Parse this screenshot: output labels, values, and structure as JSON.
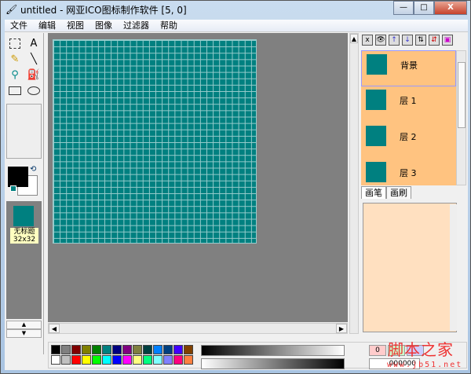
{
  "window": {
    "title": "untitled - 网亚ICO图标制作软件 [5, 0]",
    "minimize": "—",
    "maximize": "□",
    "close": "X"
  },
  "menu": [
    "文件",
    "编辑",
    "视图",
    "图像",
    "过滤器",
    "帮助"
  ],
  "tools": {
    "text": "A",
    "line": "╲",
    "pencil": "✎",
    "picker": "⚲",
    "fill": "⛽"
  },
  "colors": {
    "foreground": "#000000",
    "background": "#FFFFFF",
    "canvas": "#008080",
    "swap": "⟲"
  },
  "icon_list": {
    "items": [
      {
        "name": "无标题",
        "size": "32x32"
      }
    ],
    "up": "▲",
    "down": "▼"
  },
  "canvas": {
    "grid_cols": 32,
    "grid_rows": 32
  },
  "layer_toolbar": [
    "x",
    "👁",
    "↑",
    "↓",
    "⇅",
    "⇵",
    "▣"
  ],
  "layers": [
    {
      "name": "背景"
    },
    {
      "name": "层 1"
    },
    {
      "name": "层 2"
    },
    {
      "name": "层 3"
    }
  ],
  "tabs": [
    "画笔",
    "画刷"
  ],
  "palette": {
    "row1": [
      "#000000",
      "#808080",
      "#800000",
      "#808000",
      "#008000",
      "#008080",
      "#000080",
      "#800080",
      "#808040",
      "#004040",
      "#0080FF",
      "#004080",
      "#4000FF",
      "#804000"
    ],
    "row2": [
      "#FFFFFF",
      "#C0C0C0",
      "#FF0000",
      "#FFFF00",
      "#00FF00",
      "#00FFFF",
      "#0000FF",
      "#FF00FF",
      "#FFFF80",
      "#00FF80",
      "#80FFFF",
      "#8080FF",
      "#FF0080",
      "#FF8040"
    ]
  },
  "color_value": "0",
  "hex_value": "000000",
  "watermark": {
    "title": "脚本之家",
    "url": "www.jb51.net"
  },
  "scroll": {
    "left": "◀",
    "right": "▶",
    "up": "▲",
    "down": "▼"
  }
}
